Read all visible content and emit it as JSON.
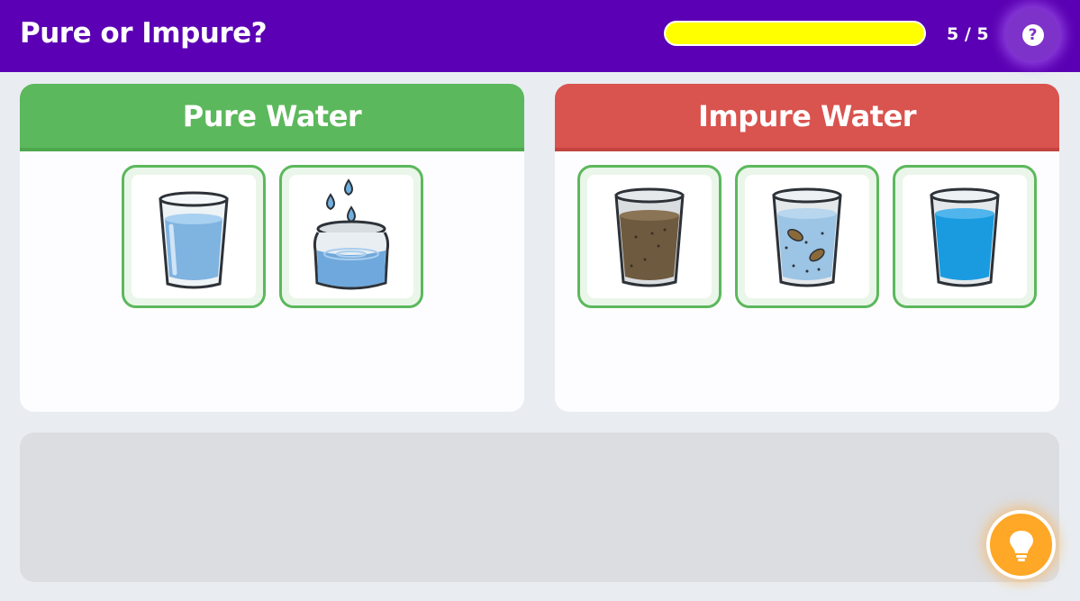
{
  "header": {
    "title": "Pure or Impure?",
    "progress": 1.0,
    "counter": "5 / 5",
    "help_icon": "question-icon"
  },
  "categories": [
    {
      "title": "Pure Water",
      "color": "#5cb85c",
      "items": [
        {
          "icon": "glass-of-clear-water-icon"
        },
        {
          "icon": "jar-with-water-drops-icon"
        }
      ]
    },
    {
      "title": "Impure Water",
      "color": "#d9534f",
      "items": [
        {
          "icon": "glass-of-muddy-water-icon"
        },
        {
          "icon": "glass-with-leaves-and-debris-icon"
        },
        {
          "icon": "glass-of-blue-water-icon"
        }
      ]
    }
  ],
  "hint_icon": "lightbulb-icon",
  "colors": {
    "header_bg": "#5b00b4",
    "progress_fill": "#ffff00",
    "hint_button": "#ffa726",
    "card_border": "#5cb85c"
  }
}
